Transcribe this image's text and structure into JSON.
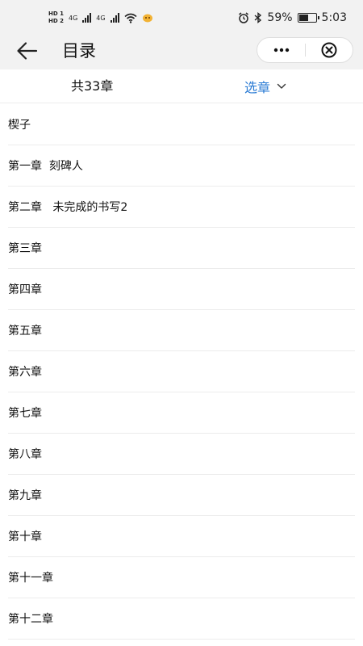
{
  "status_bar": {
    "hd1": "HD 1",
    "hd2": "HD 2",
    "net1": "4G",
    "net2": "4G",
    "battery_percent": "59%",
    "battery_level": 0.59,
    "time": "5:03"
  },
  "nav": {
    "title": "目录"
  },
  "summary": {
    "count_label": "共33章",
    "select_label": "选章"
  },
  "chapters": [
    "楔子",
    "第一章  刻碑人",
    "第二章   未完成的书写2",
    "第三章",
    "第四章",
    "第五章",
    "第六章",
    "第七章",
    "第八章",
    "第九章",
    "第十章",
    "第十一章",
    "第十二章"
  ],
  "colors": {
    "accent": "#2a7bd4",
    "bar_bg": "#f2f2f2",
    "divider": "#ececec"
  }
}
